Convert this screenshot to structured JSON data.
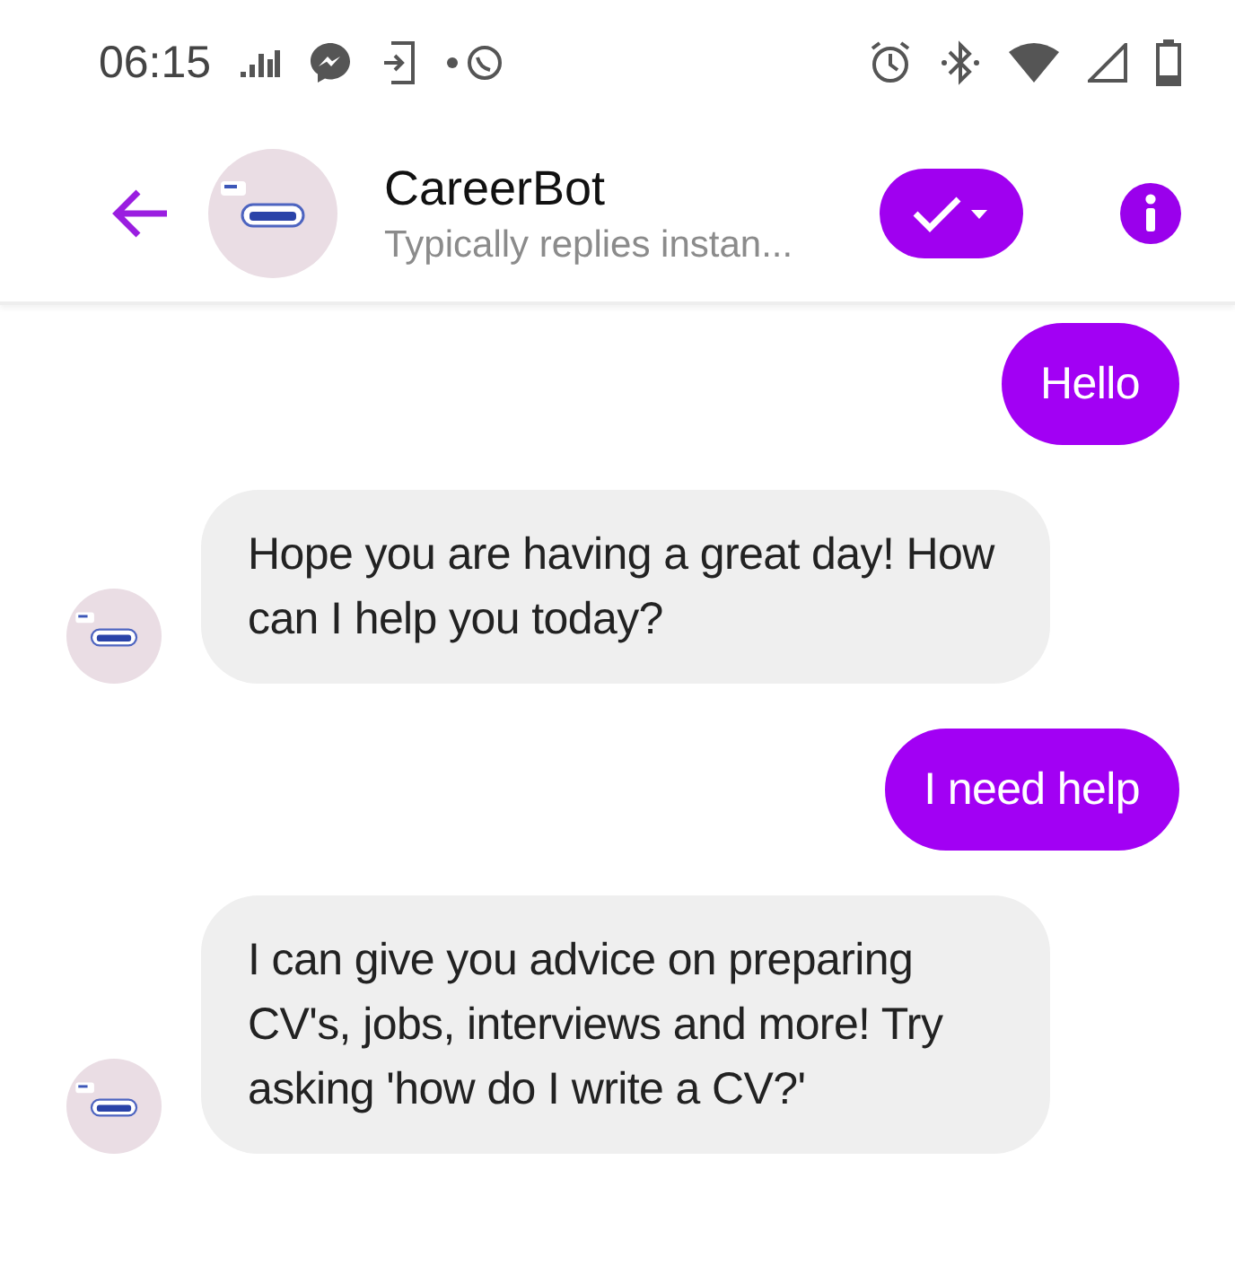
{
  "status_bar": {
    "time": "06:15"
  },
  "header": {
    "title": "CareerBot",
    "subtitle": "Typically replies instan..."
  },
  "messages": [
    {
      "kind": "sent",
      "text": "Hello"
    },
    {
      "kind": "received",
      "text": "Hope you are having a great day! How can I help you today?"
    },
    {
      "kind": "sent",
      "text": "I need help"
    },
    {
      "kind": "received",
      "text": "I can give you advice on preparing CV's, jobs, interviews and more! Try asking 'how do I write a CV?'"
    }
  ]
}
